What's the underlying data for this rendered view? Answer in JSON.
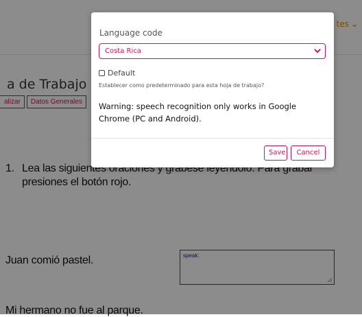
{
  "header": {
    "link_fragment": "tes"
  },
  "worksheet": {
    "title_fragment": "a de Trabajo",
    "tabs": [
      "alizar",
      "Datos Generales"
    ],
    "instruction": {
      "number": "1.",
      "line1": "Lea las siguientes oraciones y grabese leyendolo.   Para grabar",
      "line2": "presiones el botón rojo."
    },
    "sentences": [
      "Juan comió pastel.",
      "Mi hermano no fue al parque."
    ],
    "speak_label": "speak:"
  },
  "modal": {
    "label": "Language code",
    "select_value": "Costa Rica",
    "default_label": "Default",
    "default_help": "Establecer como predeterminado para esta hoja de trabajo?",
    "warning": "Warning: speech recognition only works in Google Chrome (PC and Android).",
    "save_label": "Save",
    "cancel_label": "Cancel"
  },
  "colors": {
    "accent": "#c2185b",
    "header_link": "#e08a00"
  }
}
